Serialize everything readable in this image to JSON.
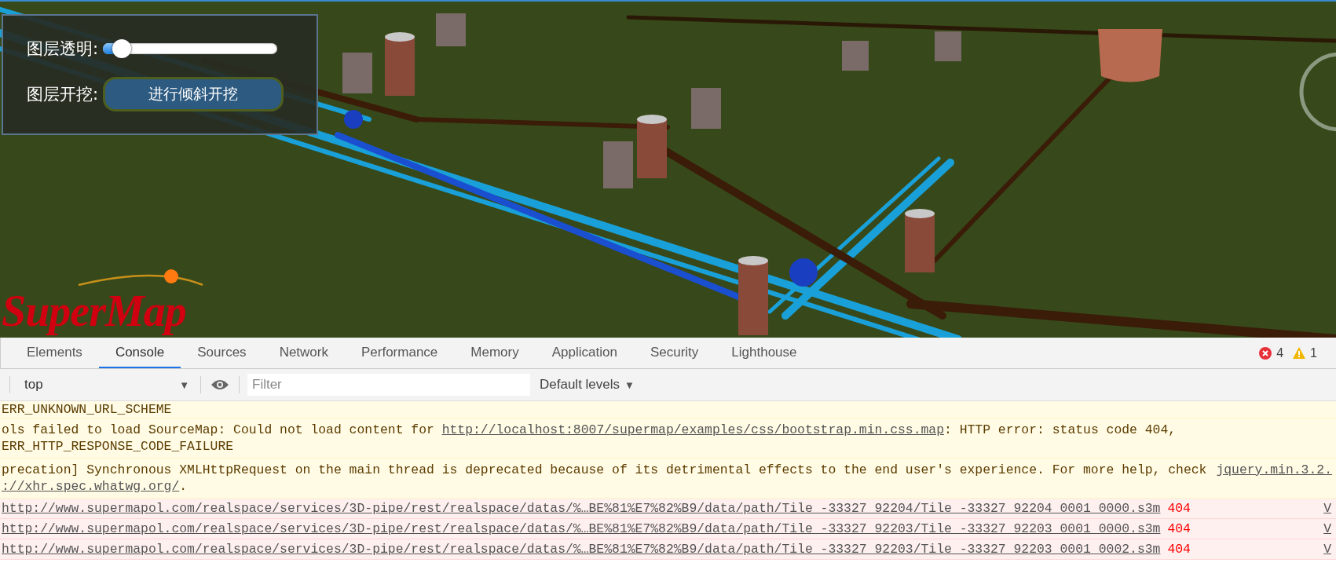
{
  "map_panel": {
    "opacity_label": "图层透明:",
    "opacity_slider": {
      "level": 0.06
    },
    "excavation_label": "图层开挖:",
    "excavation_button": "进行倾斜开挖"
  },
  "logo": "SuperMap",
  "devtools": {
    "tabs": [
      {
        "label": "Elements",
        "selected": false
      },
      {
        "label": "Console",
        "selected": true
      },
      {
        "label": "Sources",
        "selected": false
      },
      {
        "label": "Network",
        "selected": false
      },
      {
        "label": "Performance",
        "selected": false
      },
      {
        "label": "Memory",
        "selected": false
      },
      {
        "label": "Application",
        "selected": false
      },
      {
        "label": "Security",
        "selected": false
      },
      {
        "label": "Lighthouse",
        "selected": false
      }
    ],
    "error_count": "4",
    "warning_count": "1",
    "context": "top",
    "context_caret": "▼",
    "filter_placeholder": "Filter",
    "levels": "Default levels",
    "levels_caret": "▼",
    "messages": [
      {
        "kind": "warning",
        "lines": [
          [
            {
              "text": "ERR_UNKNOWN_URL_SCHEME",
              "kind": "text"
            }
          ]
        ]
      },
      {
        "kind": "warning",
        "lines": [
          [
            {
              "text": "ols failed to load SourceMap: Could not load content for ",
              "kind": "text"
            },
            {
              "text": "http://localhost:8007/supermap/examples/css/bootstrap.min.css.map",
              "kind": "link"
            },
            {
              "text": ": HTTP error: status code 404,",
              "kind": "text"
            }
          ],
          [
            {
              "text": "ERR_HTTP_RESPONSE_CODE_FAILURE",
              "kind": "text"
            }
          ]
        ]
      },
      {
        "kind": "warning",
        "source": "jquery.min.3.2.",
        "lines": [
          [
            {
              "text": "precation] Synchronous XMLHttpRequest on the main thread is deprecated because of its detrimental effects to the end user's experience. For more help, check",
              "kind": "text"
            }
          ],
          [
            {
              "text": "://xhr.spec.whatwg.org/",
              "kind": "link"
            },
            {
              "text": ".",
              "kind": "text"
            }
          ]
        ]
      },
      {
        "kind": "error",
        "status": "404",
        "source": "V",
        "lines": [
          [
            {
              "text": "http://www.supermapol.com/realspace/services/3D-pipe/rest/realspace/datas/%…BE%81%E7%82%B9/data/path/Tile_-33327_92204/Tile_-33327_92204_0001_0000.s3m",
              "kind": "link"
            }
          ]
        ]
      },
      {
        "kind": "error",
        "status": "404",
        "source": "V",
        "lines": [
          [
            {
              "text": "http://www.supermapol.com/realspace/services/3D-pipe/rest/realspace/datas/%…BE%81%E7%82%B9/data/path/Tile_-33327_92203/Tile_-33327_92203_0001_0000.s3m",
              "kind": "link"
            }
          ]
        ]
      },
      {
        "kind": "error",
        "status": "404",
        "source": "V",
        "lines": [
          [
            {
              "text": "http://www.supermapol.com/realspace/services/3D-pipe/rest/realspace/datas/%…BE%81%E7%82%B9/data/path/Tile_-33327_92203/Tile_-33327_92203_0001_0002.s3m",
              "kind": "link"
            }
          ]
        ]
      }
    ]
  }
}
